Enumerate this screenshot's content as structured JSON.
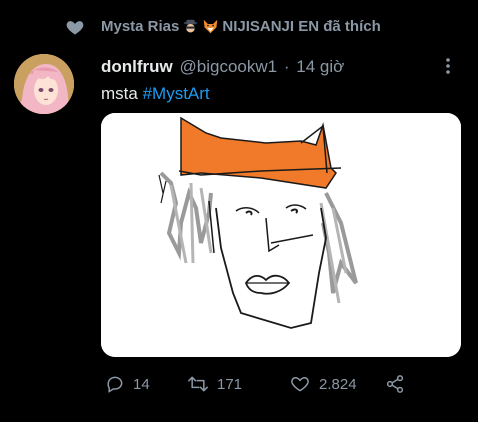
{
  "social_context": {
    "icon": "heart-icon",
    "text": "Mysta Rias",
    "emoji_1": "detective-emoji",
    "emoji_2": "fox-emoji",
    "text_2": "NIJISANJI EN đã thích"
  },
  "author": {
    "display_name": "donlfruw",
    "handle": "@bigcookw1",
    "separator": "·",
    "time": "14 giờ"
  },
  "tweet": {
    "text": "msta",
    "hashtag": "#MystArt"
  },
  "actions": {
    "reply_count": "14",
    "retweet_count": "171",
    "like_count": "2.824"
  },
  "colors": {
    "background": "#000000",
    "text_primary": "#e7e9ea",
    "text_secondary": "#8b98a5",
    "accent": "#1d9bf0",
    "drawing_orange": "#f07a2a"
  }
}
